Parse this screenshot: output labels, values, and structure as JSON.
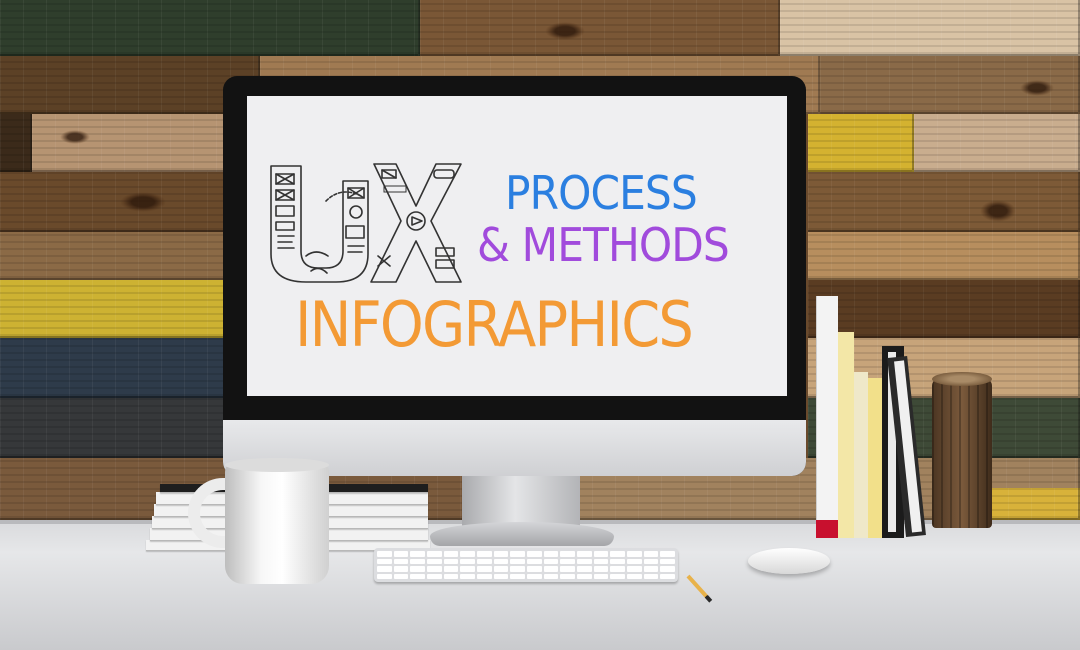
{
  "screen": {
    "line1": "PROCESS",
    "line2": "& METHODS",
    "line3": "INFOGRAPHICS",
    "logo_text": "UX"
  },
  "colors": {
    "process": "#2b7fe0",
    "methods": "#a14bdc",
    "infographics": "#f39a35",
    "screen_bg": "#efeff1"
  },
  "icons": [
    "ux-sketch-logo-icon"
  ]
}
